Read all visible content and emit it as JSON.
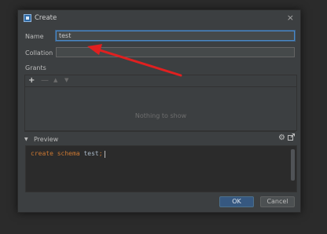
{
  "dialog": {
    "title": "Create",
    "close_symbol": "×"
  },
  "form": {
    "name_label": "Name",
    "name_value": "test",
    "collation_label": "Collation",
    "collation_value": ""
  },
  "grants": {
    "label": "Grants",
    "toolbar": {
      "add": "+",
      "remove": "—",
      "up": "▲",
      "down": "▼"
    },
    "empty_text": "Nothing to show"
  },
  "preview": {
    "label": "Preview",
    "code_keyword1": "create",
    "code_keyword2": "schema",
    "code_ident": "test",
    "code_semi": ";"
  },
  "buttons": {
    "ok": "OK",
    "cancel": "Cancel"
  },
  "icons": {
    "app": "datagrip-app-icon",
    "settings": "gear-icon",
    "open_in_editor": "external-link-icon",
    "expand": "triangle-down-icon"
  },
  "colors": {
    "annotation_arrow": "#e02020",
    "ok_button": "#365880",
    "focus_border": "#4a88c7",
    "keyword": "#cc7832"
  }
}
